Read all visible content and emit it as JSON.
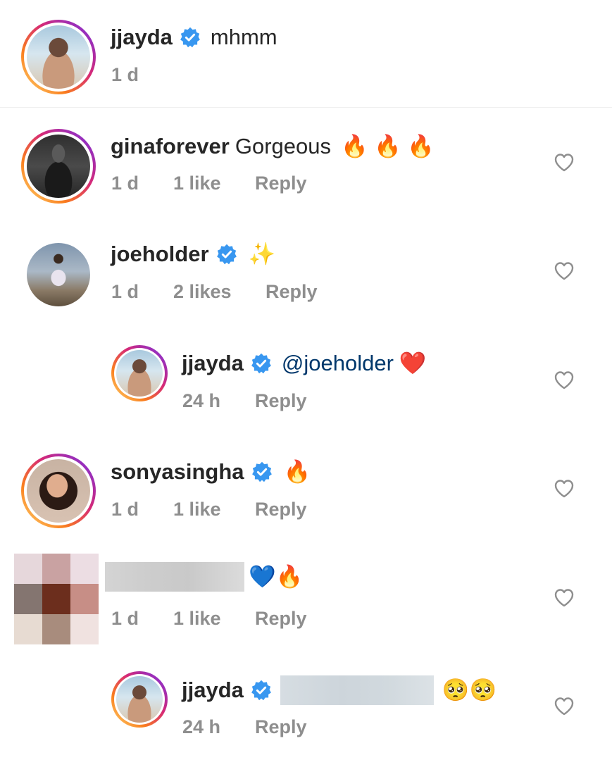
{
  "caption": {
    "username": "jjayda",
    "text": "mhmm",
    "time": "1 d"
  },
  "comments": [
    {
      "username": "ginaforever",
      "text": "Gorgeous",
      "emoji": "🔥 🔥 🔥",
      "time": "1 d",
      "likes": "1 like",
      "reply": "Reply"
    },
    {
      "username": "joeholder",
      "emoji": "✨",
      "time": "1 d",
      "likes": "2 likes",
      "reply": "Reply"
    },
    {
      "username": "jjayda",
      "mention": "@joeholder",
      "emoji": "❤️",
      "time": "24 h",
      "reply": "Reply"
    },
    {
      "username": "sonyasingha",
      "emoji": "🔥",
      "time": "1 d",
      "likes": "1 like",
      "reply": "Reply"
    },
    {
      "username": "",
      "emoji": "💙🔥",
      "time": "1 d",
      "likes": "1 like",
      "reply": "Reply"
    },
    {
      "username": "jjayda",
      "emoji": "🥺🥺",
      "time": "24 h",
      "reply": "Reply"
    }
  ],
  "colors": {
    "verified": "#3897f0",
    "meta": "#8e8e8e",
    "mention": "#00376b",
    "heart_outline": "#8e8e8e"
  },
  "icons": {
    "verified": "verified-badge-icon",
    "like": "heart-outline-icon"
  }
}
